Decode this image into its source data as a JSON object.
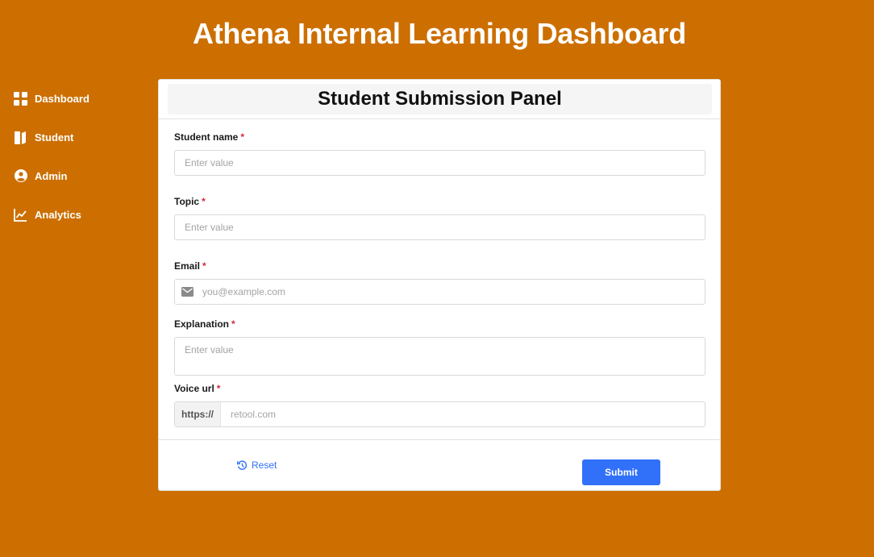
{
  "app": {
    "title": "Athena Internal Learning Dashboard"
  },
  "sidebar": {
    "items": [
      {
        "label": "Dashboard",
        "icon": "dashboard-grid-icon"
      },
      {
        "label": "Student",
        "icon": "book-icon"
      },
      {
        "label": "Admin",
        "icon": "user-circle-icon"
      },
      {
        "label": "Analytics",
        "icon": "chart-line-icon"
      }
    ]
  },
  "form": {
    "title": "Student Submission Panel",
    "required_marker": "*",
    "fields": {
      "student_name": {
        "label": "Student name",
        "placeholder": "Enter value"
      },
      "topic": {
        "label": "Topic",
        "placeholder": "Enter value"
      },
      "email": {
        "label": "Email",
        "placeholder": "you@example.com"
      },
      "explanation": {
        "label": "Explanation",
        "placeholder": "Enter value"
      },
      "voice_url": {
        "label": "Voice url",
        "prefix": "https://",
        "placeholder": "retool.com"
      }
    },
    "actions": {
      "reset_label": "Reset",
      "submit_label": "Submit"
    }
  },
  "colors": {
    "background": "#CC6F00",
    "accent": "#3170F9",
    "required": "#D7263D"
  }
}
